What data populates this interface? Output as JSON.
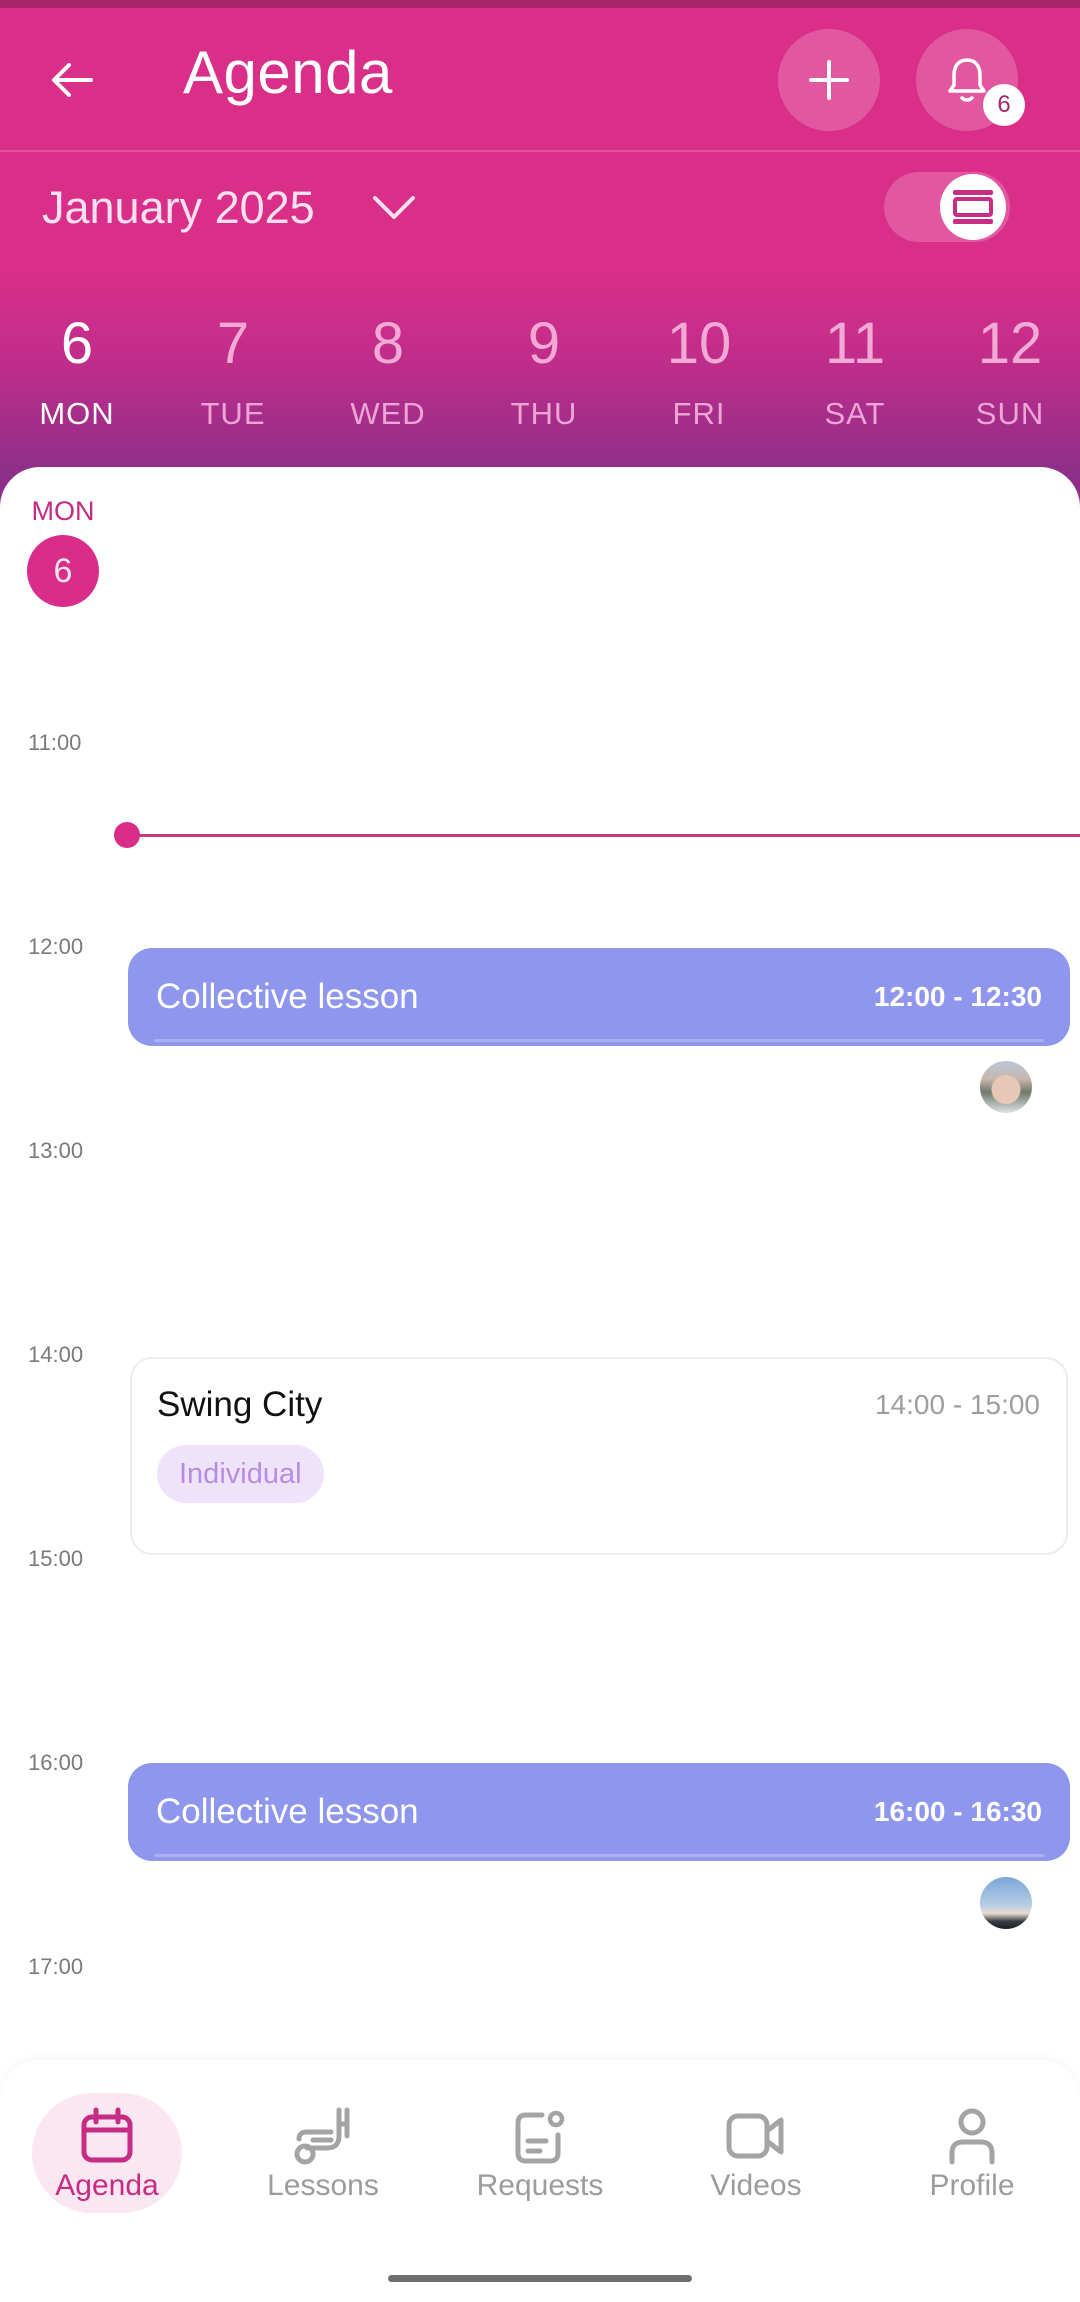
{
  "header": {
    "title": "Agenda",
    "back_icon": "arrow-left-icon",
    "add_icon": "plus-icon",
    "notifications_icon": "bell-icon",
    "notification_count": "6",
    "month_label": "January 2025",
    "month_chevron_icon": "chevron-down-icon",
    "view_toggle_icon": "calendar-view-icon",
    "view_toggle_state": "on"
  },
  "colors": {
    "brand": "#da2f89",
    "gradient_end": "#8a2f8b",
    "collective_event": "#8e96ee",
    "individual_badge_bg": "#efe3fb",
    "individual_badge_text": "#b58ee0"
  },
  "week": {
    "days": [
      {
        "num": "6",
        "weekday": "MON",
        "active": true
      },
      {
        "num": "7",
        "weekday": "TUE",
        "active": false
      },
      {
        "num": "8",
        "weekday": "WED",
        "active": false
      },
      {
        "num": "9",
        "weekday": "THU",
        "active": false
      },
      {
        "num": "10",
        "weekday": "FRI",
        "active": false
      },
      {
        "num": "11",
        "weekday": "SAT",
        "active": false
      },
      {
        "num": "12",
        "weekday": "SUN",
        "active": false
      }
    ]
  },
  "selected_day": {
    "weekday": "MON",
    "num": "6"
  },
  "timeline": {
    "hours": [
      "11:00",
      "12:00",
      "13:00",
      "14:00",
      "15:00",
      "16:00",
      "17:00"
    ],
    "current_time_indicator": "11:27"
  },
  "events": [
    {
      "type": "collective",
      "title": "Collective lesson",
      "time": "12:00 - 12:30",
      "avatar": "participant-avatar"
    },
    {
      "type": "individual",
      "title": "Swing City",
      "time": "14:00 - 15:00",
      "badge": "Individual"
    },
    {
      "type": "collective",
      "title": "Collective lesson",
      "time": "16:00 - 16:30",
      "avatar": "participant-avatar"
    }
  ],
  "bottom_nav": {
    "items": [
      {
        "label": "Agenda",
        "icon": "calendar-icon",
        "active": true
      },
      {
        "label": "Lessons",
        "icon": "golf-bag-icon",
        "active": false
      },
      {
        "label": "Requests",
        "icon": "request-card-icon",
        "active": false
      },
      {
        "label": "Videos",
        "icon": "video-camera-icon",
        "active": false
      },
      {
        "label": "Profile",
        "icon": "person-icon",
        "active": false
      }
    ]
  }
}
